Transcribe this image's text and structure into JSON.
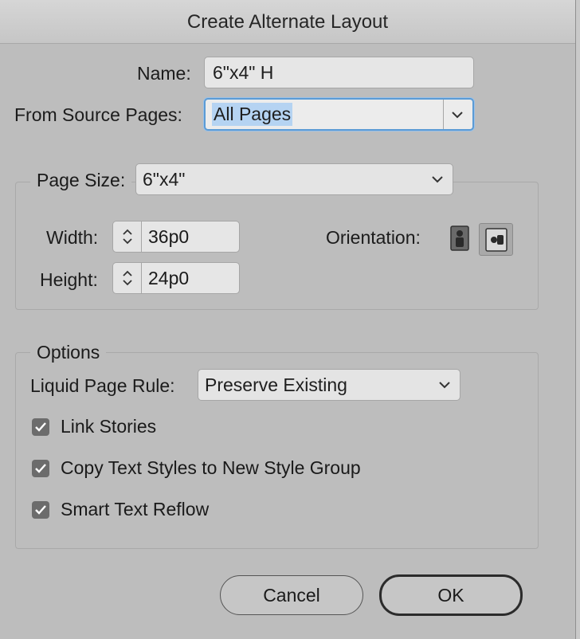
{
  "dialog": {
    "title": "Create Alternate Layout"
  },
  "name_field": {
    "label": "Name:",
    "value": "6\"x4\" H"
  },
  "source_pages": {
    "label": "From Source Pages:",
    "value": "All Pages"
  },
  "page_size": {
    "label": "Page Size:",
    "value": "6\"x4\"",
    "width": {
      "label": "Width:",
      "value": "36p0"
    },
    "height": {
      "label": "Height:",
      "value": "24p0"
    },
    "orientation": {
      "label": "Orientation:",
      "options": [
        "portrait-icon",
        "landscape-icon"
      ],
      "selected": "landscape"
    }
  },
  "options": {
    "legend": "Options",
    "liquid_rule": {
      "label": "Liquid Page Rule:",
      "value": "Preserve Existing"
    },
    "checkboxes": [
      {
        "label": "Link Stories",
        "checked": true
      },
      {
        "label": "Copy Text Styles to New Style Group",
        "checked": true
      },
      {
        "label": "Smart Text Reflow",
        "checked": true
      }
    ]
  },
  "buttons": {
    "cancel": "Cancel",
    "ok": "OK"
  }
}
